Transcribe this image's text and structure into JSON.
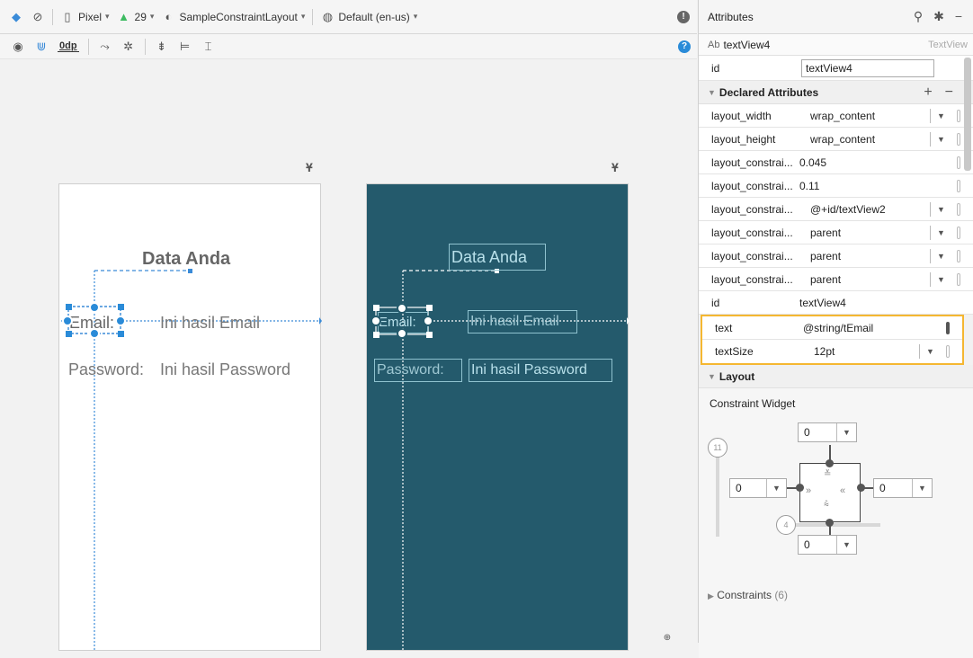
{
  "toolbar": {
    "device": "Pixel",
    "api": "29",
    "theme": "SampleConstraintLayout",
    "locale": "Default (en-us)",
    "margin": "0dp"
  },
  "design": {
    "title": "Data Anda",
    "email_label": "Email:",
    "email_value": "Ini hasil Email",
    "password_label": "Password:",
    "password_value": "Ini hasil Password"
  },
  "blueprint": {
    "title": "Data Anda",
    "email_label": "Email:",
    "email_value": "Ini hasil Email",
    "password_label": "Password:",
    "password_value": "Ini hasil Password"
  },
  "attributes": {
    "header": "Attributes",
    "component_name": "textView4",
    "component_type": "TextView",
    "id_label": "id",
    "id_value": "textView4",
    "declared_label": "Declared Attributes",
    "rows": [
      {
        "key": "layout_width",
        "value": "wrap_content"
      },
      {
        "key": "layout_height",
        "value": "wrap_content"
      },
      {
        "key": "layout_constrai...",
        "value": "0.045"
      },
      {
        "key": "layout_constrai...",
        "value": "0.11"
      },
      {
        "key": "layout_constrai...",
        "value": "@+id/textView2"
      },
      {
        "key": "layout_constrai...",
        "value": "parent"
      },
      {
        "key": "layout_constrai...",
        "value": "parent"
      },
      {
        "key": "layout_constrai...",
        "value": "parent"
      },
      {
        "key": "id",
        "value": "textView4"
      },
      {
        "key": "text",
        "value": "@string/tEmail"
      },
      {
        "key": "textSize",
        "value": "12pt"
      }
    ],
    "layout_label": "Layout",
    "constraint_widget_label": "Constraint Widget",
    "margins": {
      "top": "0",
      "left": "0",
      "right": "0",
      "bottom": "0"
    },
    "bias_vertical": "11",
    "bias_horizontal": "4",
    "constraints_label": "Constraints",
    "constraints_count": "(6)"
  }
}
